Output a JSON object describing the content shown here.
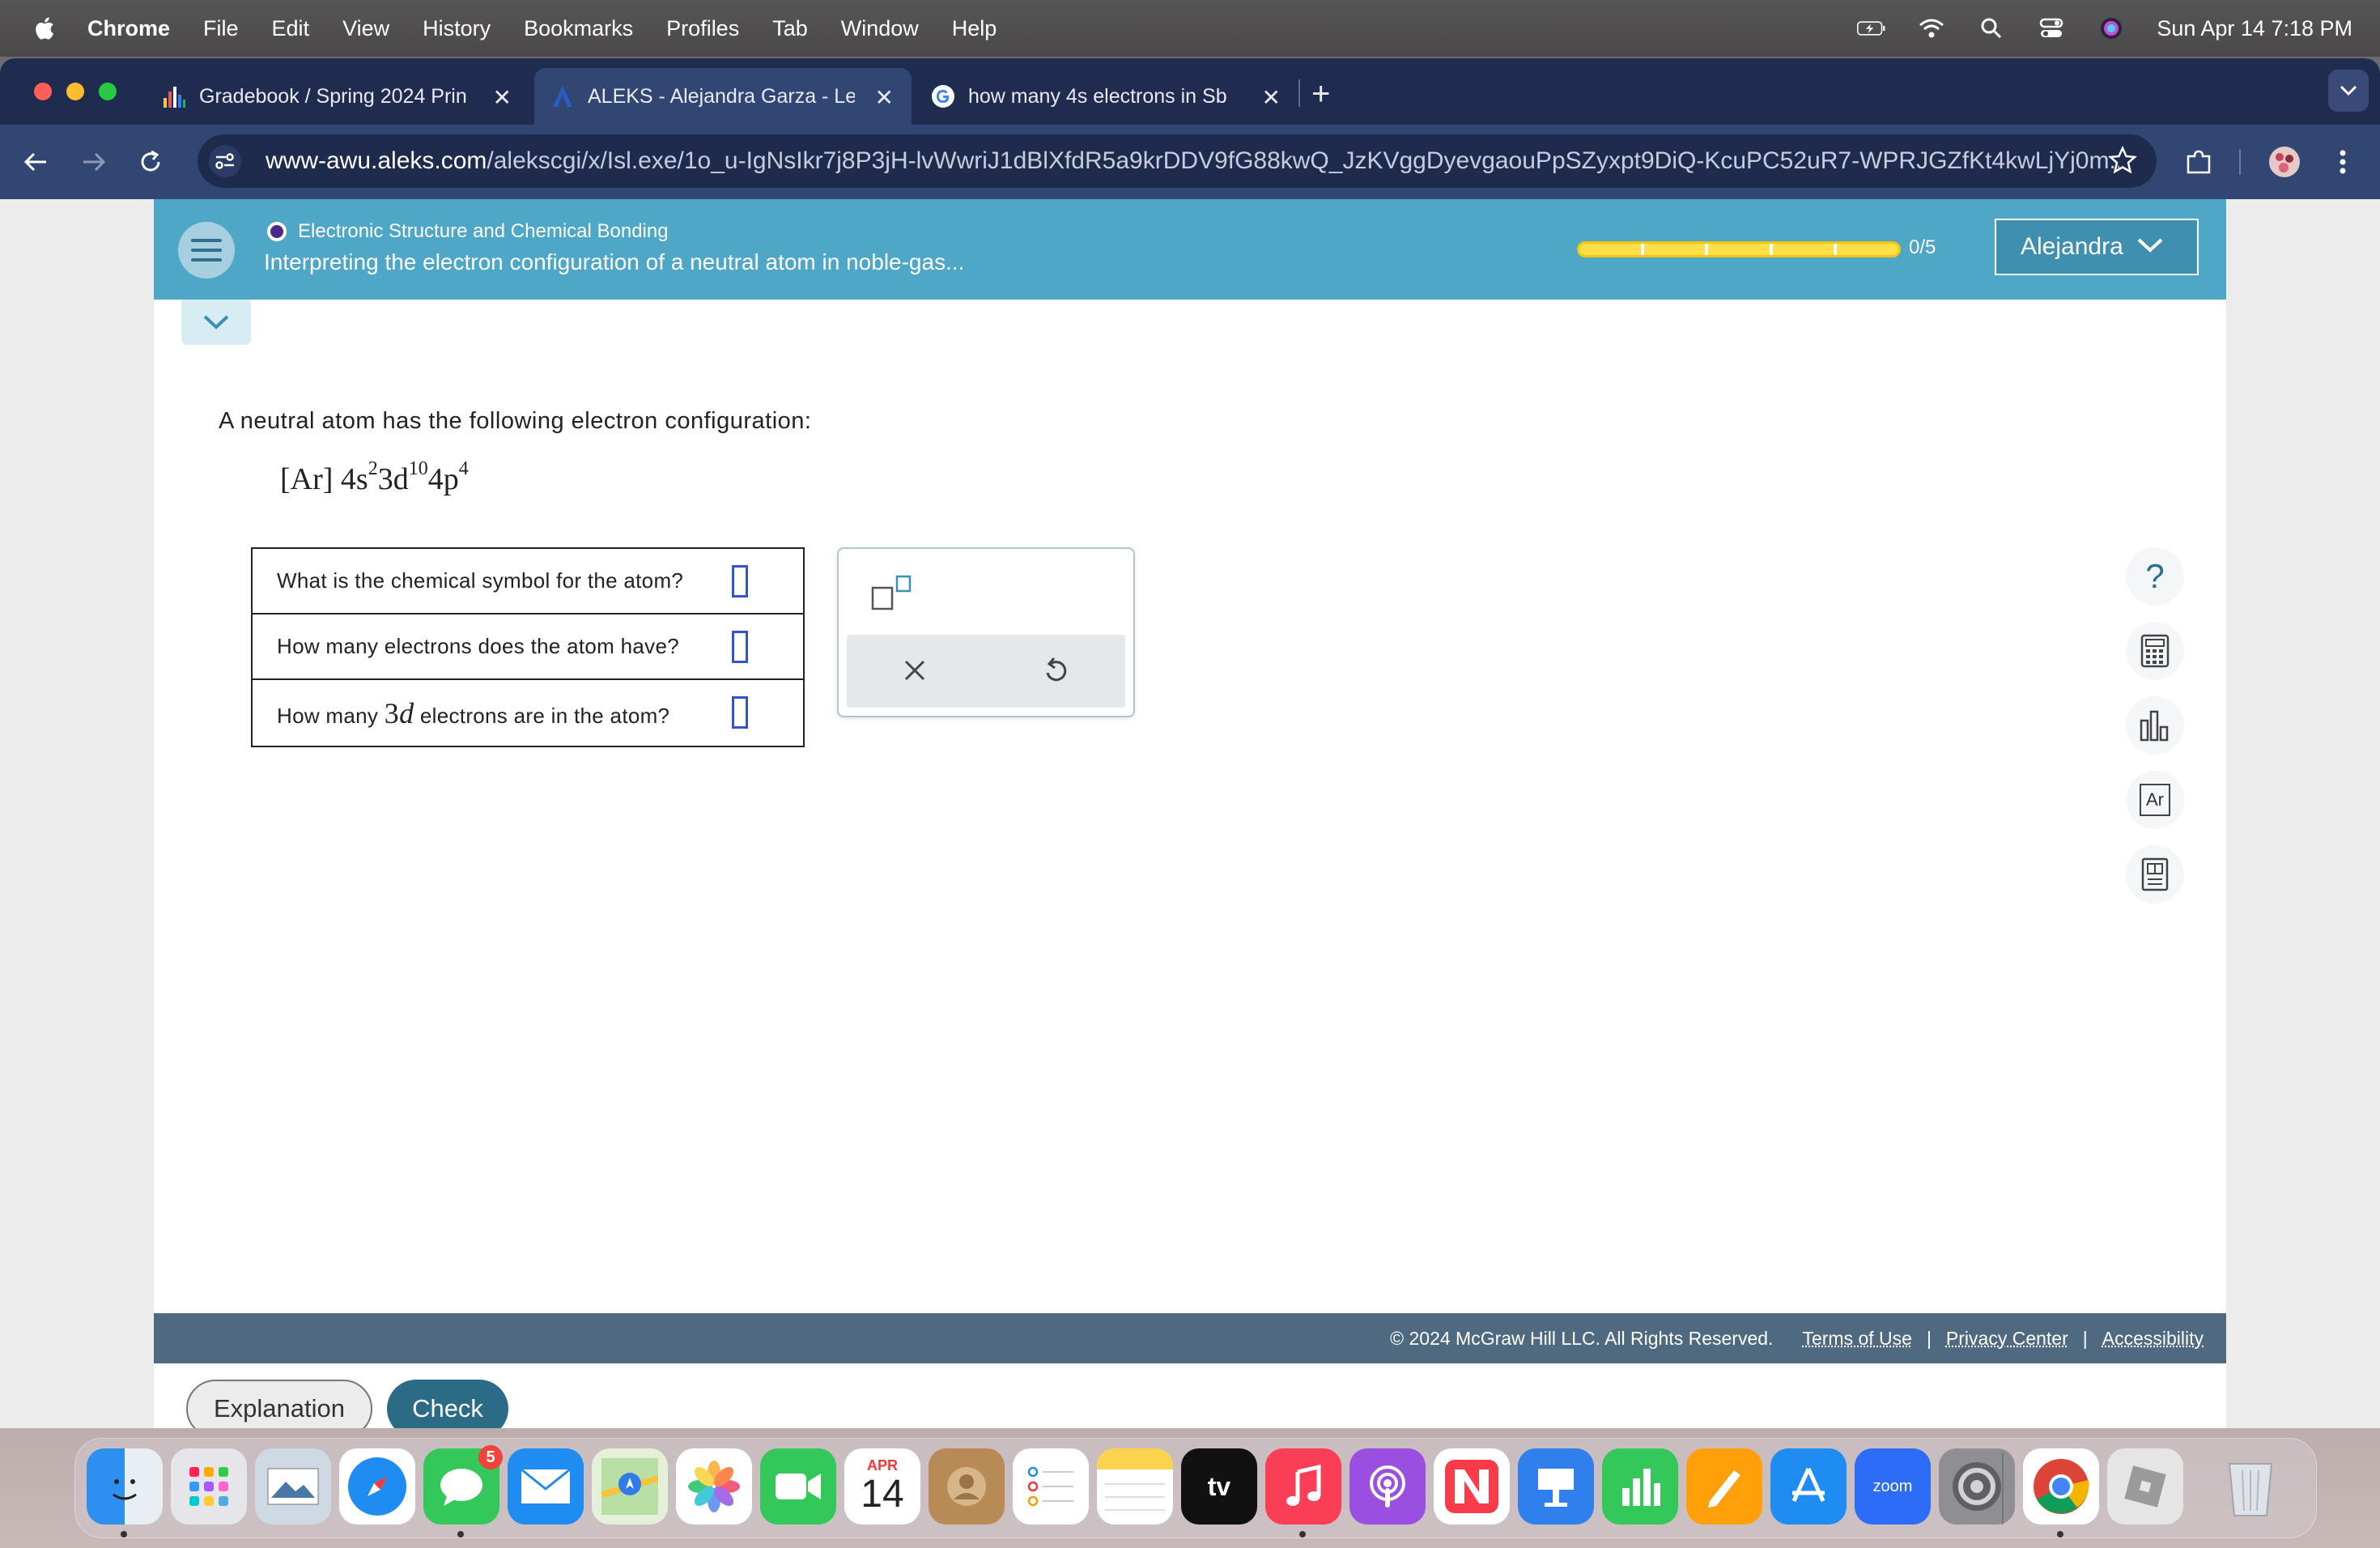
{
  "menubar": {
    "app": "Chrome",
    "items": [
      "File",
      "Edit",
      "View",
      "History",
      "Bookmarks",
      "Profiles",
      "Tab",
      "Window",
      "Help"
    ],
    "clock": "Sun Apr 14  7:18 PM"
  },
  "tabs": [
    {
      "title": "Gradebook / Spring 2024 Prin",
      "icon": "bar-chart-favicon"
    },
    {
      "title": "ALEKS - Alejandra Garza - Le",
      "icon": "aleks-favicon"
    },
    {
      "title": "how many 4s electrons in Sb",
      "icon": "google-favicon"
    }
  ],
  "omnibox": {
    "host": "www-awu.aleks.com",
    "path": "/alekscgi/x/Isl.exe/1o_u-IgNsIkr7j8P3jH-lvWwriJ1dBlXfdR5a9krDDV9fG88kwQ_JzKVggDyevgaouPpSZyxpt9DiQ-KcuPC52uR7-WPRJGZfKt4kwLjYj0m..."
  },
  "aleks": {
    "topic": "Electronic Structure and Chemical Bonding",
    "subtitle": "Interpreting the electron configuration of a neutral atom in noble-gas...",
    "progress": {
      "done": 0,
      "total": 5,
      "label": "0/5"
    },
    "user": "Alejandra",
    "question": "A neutral atom has the following electron configuration:",
    "config": {
      "core": "[Ar]",
      "s_shell": "4s",
      "s_count": "2",
      "d_shell": "3d",
      "d_count": "10",
      "p_shell": "4p",
      "p_count": "4"
    },
    "rows": [
      {
        "text": "What is the chemical symbol for the atom?"
      },
      {
        "text": "How many electrons does the atom have?"
      },
      {
        "text_pre": "How many",
        "num": "3",
        "var": "d",
        "text_post": "electrons are in the atom?"
      }
    ],
    "buttons": {
      "explanation": "Explanation",
      "check": "Check"
    },
    "tool_ptable": "Ar"
  },
  "footer": {
    "copyright": "© 2024 McGraw Hill LLC. All Rights Reserved.",
    "terms": "Terms of Use",
    "privacy": "Privacy Center",
    "accessibility": "Accessibility"
  },
  "dock": {
    "messages_badge": "5",
    "calendar_month": "APR",
    "calendar_day": "14",
    "tv_label": "tv",
    "zoom_label": "zoom"
  },
  "colors": {
    "aleks_header": "#4fa7c7",
    "check_button": "#2b6b86",
    "tab_strip": "#1f2c4f",
    "toolbar": "#324673"
  }
}
